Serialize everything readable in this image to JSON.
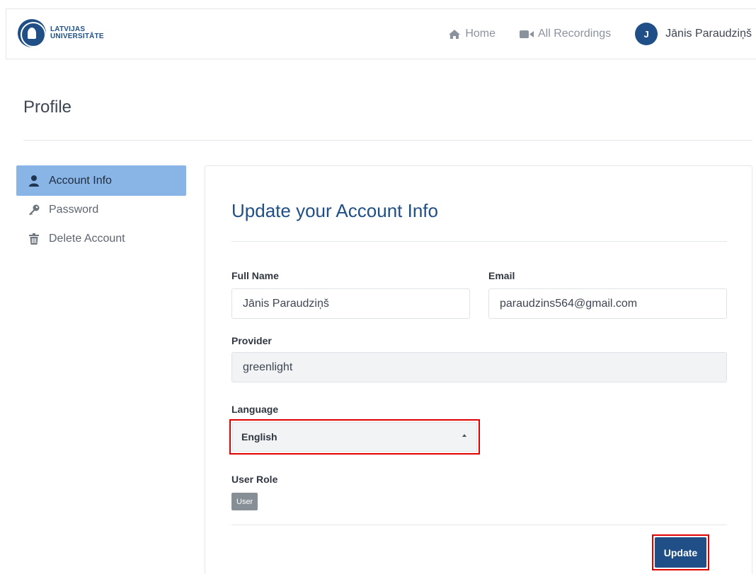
{
  "brand": {
    "line1": "LATVIJAS",
    "line2": "UNIVERSITĀTE"
  },
  "nav": {
    "home": "Home",
    "recordings": "All Recordings",
    "avatar_initial": "J",
    "user_name": "Jānis Paraudziņš"
  },
  "page": {
    "title": "Profile"
  },
  "sidebar": {
    "items": [
      {
        "label": "Account Info",
        "icon": "user-icon"
      },
      {
        "label": "Password",
        "icon": "key-icon"
      },
      {
        "label": "Delete Account",
        "icon": "trash-icon"
      }
    ]
  },
  "form": {
    "title": "Update your Account Info",
    "full_name": {
      "label": "Full Name",
      "value": "Jānis Paraudziņš"
    },
    "email": {
      "label": "Email",
      "value": "paraudzins564@gmail.com"
    },
    "provider": {
      "label": "Provider",
      "value": "greenlight"
    },
    "language": {
      "label": "Language",
      "value": "English"
    },
    "user_role": {
      "label": "User Role",
      "badge": "User"
    },
    "submit": "Update"
  },
  "colors": {
    "brand": "#1f4f86",
    "active_tab": "#89b4e6",
    "highlight": "#e00000"
  }
}
